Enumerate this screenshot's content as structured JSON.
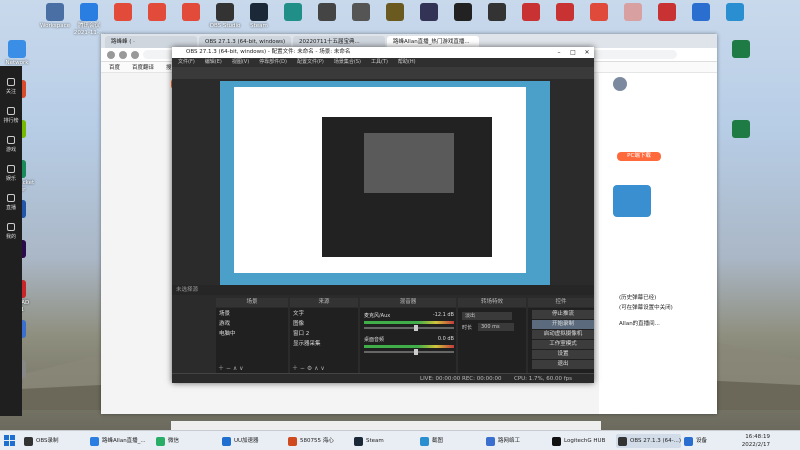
{
  "desktop_icons_top": [
    {
      "label": "Workspace",
      "color": "#4a6fa5"
    },
    {
      "label": "腾讯会议 2021-11-...",
      "color": "#2a7de1"
    },
    {
      "label": "",
      "color": "#e24a3a"
    },
    {
      "label": "",
      "color": "#e24a3a"
    },
    {
      "label": "",
      "color": "#e24a3a"
    },
    {
      "label": "OBS Studio",
      "color": "#333333"
    },
    {
      "label": "Steam",
      "color": "#1b2838"
    },
    {
      "label": "",
      "color": "#1f8f87"
    },
    {
      "label": "",
      "color": "#444444"
    },
    {
      "label": "",
      "color": "#555555"
    },
    {
      "label": "",
      "color": "#6a5a1f"
    },
    {
      "label": "",
      "color": "#333355"
    },
    {
      "label": "",
      "color": "#222222"
    },
    {
      "label": "",
      "color": "#333333"
    },
    {
      "label": "",
      "color": "#c83232"
    },
    {
      "label": "",
      "color": "#c83232"
    },
    {
      "label": "",
      "color": "#e04a3a"
    },
    {
      "label": "",
      "color": "#d8a0a0"
    },
    {
      "label": "",
      "color": "#c83232"
    },
    {
      "label": "",
      "color": "#2a6fd0"
    },
    {
      "label": "",
      "color": "#2a8fd0"
    }
  ],
  "desktop_icons_left": [
    {
      "label": "Network",
      "color": "#3a8ee6"
    },
    {
      "label": "",
      "color": "#d94a2a"
    },
    {
      "label": "",
      "color": "#76b900"
    },
    {
      "label": "Cisco Packet Tracer",
      "color": "#1a8a5a"
    },
    {
      "label": "",
      "color": "#2255aa"
    },
    {
      "label": "Pr",
      "color": "#2a0a4a"
    },
    {
      "label": "AutoCAD 2021",
      "color": "#c8242a"
    },
    {
      "label": "",
      "color": "#3a6fd0"
    },
    {
      "label": "MU",
      "color": "#888888"
    }
  ],
  "desktop_icons_right": [
    {
      "label": "",
      "color": "#1e7b44"
    },
    {
      "label": "",
      "color": "#1e7b44"
    }
  ],
  "browser": {
    "tabs": [
      "路峰峰 ( ·",
      "OBS 27.1.3 (64-bit, windows)",
      "20220711十五届宝典...",
      "路峰Allan直播_热门游戏直播..."
    ],
    "bookmarks": [
      "百度",
      "百度翻译",
      "搜狗搜索引擎"
    ],
    "right_panel": {
      "pc_button": "PC端下载",
      "fragments": [
        "(历史弹幕已经)",
        "(可在弹幕设置中关闭)",
        "Allan的直播间..."
      ]
    }
  },
  "side_strip": [
    "关注",
    "排行榜",
    "游戏",
    "娱乐",
    "直播",
    "我的"
  ],
  "obs": {
    "title": "OBS 27.1.3 (64-bit, windows) - 配置文件: 未命名 - 场景: 未命名",
    "menu": [
      "文件(F)",
      "编辑(E)",
      "视图(V)",
      "停靠部件(D)",
      "配置文件(P)",
      "场景集合(S)",
      "工具(T)",
      "帮助(H)"
    ],
    "source_bar": "未选择源",
    "dock_heads": [
      "场景",
      "来源",
      "混音器",
      "转场特效",
      "控件"
    ],
    "scenes": [
      "场景",
      "游戏",
      "电脑中"
    ],
    "sources": [
      "文字",
      "图像",
      "窗口 2",
      "显示器采集"
    ],
    "mixer": [
      {
        "label": "麦克风/Aux",
        "level": "-12.1 dB"
      },
      {
        "label": "桌面音频",
        "level": "0.0 dB"
      }
    ],
    "transition": {
      "type": "淡出",
      "duration_label": "时长",
      "duration": "300 ms"
    },
    "controls": [
      "停止推流",
      "开始录制",
      "启动虚拟摄像机",
      "工作室模式",
      "设置",
      "退出"
    ],
    "status": {
      "live": "LIVE: 00:00:00",
      "rec": "REC: 00:00:00",
      "cpu": "CPU: 1.7%, 60.00 fps"
    }
  },
  "taskbar": {
    "items": [
      {
        "label": "OBS录制",
        "color": "#333333"
      },
      {
        "label": "路峰Allan直播_...",
        "color": "#2a7de1"
      },
      {
        "label": "微信",
        "color": "#2aae67"
      },
      {
        "label": "UU加速器",
        "color": "#1f6fd0"
      },
      {
        "label": "580755 海心",
        "color": "#d04a1f"
      },
      {
        "label": "Steam",
        "color": "#1b2838"
      },
      {
        "label": "截图",
        "color": "#2a8fd0"
      },
      {
        "label": "路网络工",
        "color": "#3a6fd0"
      },
      {
        "label": "LogitechG HUB",
        "color": "#111111"
      },
      {
        "label": "OBS 27.1.3 (64-...)",
        "color": "#333333"
      },
      {
        "label": "设备",
        "color": "#2a6fd0"
      }
    ],
    "time": "16:48:19",
    "date": "2022/2/17"
  }
}
